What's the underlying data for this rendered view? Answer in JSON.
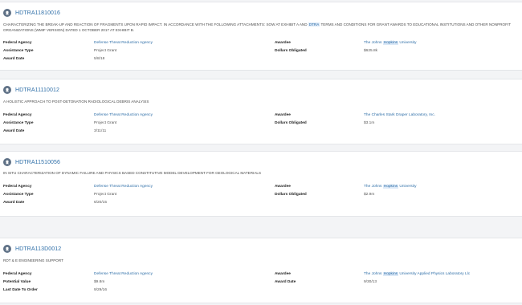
{
  "awards": [
    {
      "id": "HDTRA11810016",
      "description_parts": [
        {
          "text": "CHARACTERIZING THE BREAK-UP AND REACTION OF FRAGMENTS UPON RAPID IMPACT. IN ACCORDANCE WITH THE FOLLOWING ATTACHMENTS: SOW AT EXHIBIT A AND ",
          "hl": false
        },
        {
          "text": "DTRA",
          "hl": true
        },
        {
          "text": " TERMS AND CONDITIONS FOR GRANT AWARDS TO EDUCATIONAL INSTITUTIONS AND OTHER NONPROFIT ORGANIZATIONS (WMIF VERSION) DATED 1 OCTOBER 2017 AT EXHIBIT B.",
          "hl": false
        }
      ],
      "fields": {
        "federal_agency_label": "Federal Agency",
        "federal_agency_value": "Defense Threat Reduction Agency",
        "assistance_type_label": "Assistance Type",
        "assistance_type_value": "Project Grant",
        "award_date_label": "Award Date",
        "award_date_value": "5/8/18",
        "awardee_label": "Awardee",
        "awardee_parts": [
          {
            "text": "The Johns ",
            "hl": false
          },
          {
            "text": "Hopkins",
            "hl": true
          },
          {
            "text": " University",
            "hl": false
          }
        ],
        "dollars_label": "Dollars Obligated",
        "dollars_value": "$625.8k"
      }
    },
    {
      "id": "HDTRA11110012",
      "description_parts": [
        {
          "text": "A HOLISTIC APPROACH TO POST-DETONATION RADIOLOGICAL DEBRIS ANALYSIS",
          "hl": false
        }
      ],
      "fields": {
        "federal_agency_label": "Federal Agency",
        "federal_agency_value": "Defense Threat Reduction Agency",
        "assistance_type_label": "Assistance Type",
        "assistance_type_value": "Project Grant",
        "award_date_label": "Award Date",
        "award_date_value": "3/11/11",
        "awardee_label": "Awardee",
        "awardee_parts": [
          {
            "text": "The Charles Stark Draper Laboratory, Inc.",
            "hl": false
          }
        ],
        "dollars_label": "Dollars Obligated",
        "dollars_value": "$3.1m"
      }
    },
    {
      "id": "HDTRA11510056",
      "description_parts": [
        {
          "text": "IN SITU CHARACTERIZATION OF DYNAMIC FAILURE AND PHYSICS BASED CONSTITUTIVE MODEL DEVELOPMENT FOR GEOLOGICAL MATERIALS",
          "hl": false
        }
      ],
      "fields": {
        "federal_agency_label": "Federal Agency",
        "federal_agency_value": "Defense Threat Reduction Agency",
        "assistance_type_label": "Assistance Type",
        "assistance_type_value": "Project Grant",
        "award_date_label": "Award Date",
        "award_date_value": "6/20/15",
        "awardee_label": "Awardee",
        "awardee_parts": [
          {
            "text": "The Johns ",
            "hl": false
          },
          {
            "text": "Hopkins",
            "hl": true
          },
          {
            "text": " University",
            "hl": false
          }
        ],
        "dollars_label": "Dollars Obligated",
        "dollars_value": "$2.9m"
      }
    },
    {
      "id": "HDTRA113D0012",
      "description_parts": [
        {
          "text": "RDT & E ENGINEERING SUPPORT",
          "hl": false
        }
      ],
      "fields": {
        "federal_agency_label": "Federal Agency",
        "federal_agency_value": "Defense Threat Reduction Agency",
        "potential_value_label": "Potential Value",
        "potential_value_value": "$9.8m",
        "last_date_label": "Last Date To Order",
        "last_date_value": "9/29/16",
        "awardee_label": "Awardee",
        "awardee_parts": [
          {
            "text": "The Johns ",
            "hl": false
          },
          {
            "text": "Hopkins",
            "hl": true
          },
          {
            "text": " University Applied Physics Laboratory Llc",
            "hl": false
          }
        ],
        "award_date_label": "Award Date",
        "award_date_value": "9/30/13"
      }
    }
  ],
  "colors": {
    "link": "#2f6fa8",
    "highlight_bg": "#dce9f7",
    "icon_bg": "#5f7186",
    "page_bg": "#f3f4f6"
  },
  "icons": {
    "award_badge": "award-badge-icon"
  }
}
